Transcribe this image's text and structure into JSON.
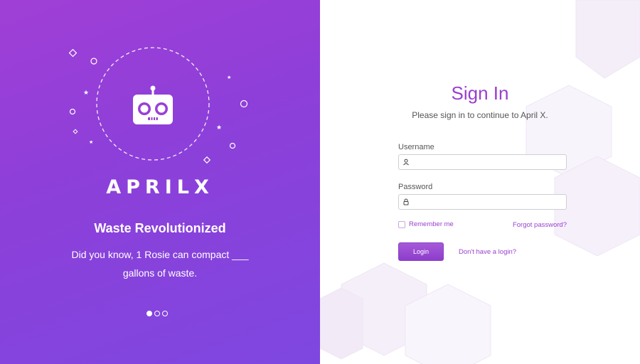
{
  "brand": {
    "logo_text": "APRILX",
    "tagline": "Waste Revolutionized",
    "fact": "Did you know, 1 Rosie can compact ___ gallons of waste.",
    "emblem_icon": "robot-icon",
    "carousel": {
      "count": 3,
      "active": 1
    }
  },
  "login": {
    "title": "Sign In",
    "subtitle": "Please sign in to continue to April X.",
    "username_label": "Username",
    "username_value": "",
    "username_icon": "user-icon",
    "password_label": "Password",
    "password_value": "",
    "password_icon": "lock-icon",
    "remember_label": "Remember me",
    "remember_checked": false,
    "forgot_label": "Forgot password?",
    "login_button": "Login",
    "no_login_link": "Don't have a login?"
  },
  "colors": {
    "accent": "#9a3fcf",
    "gradient_start": "#a03fd6",
    "gradient_end": "#7e47e0"
  }
}
